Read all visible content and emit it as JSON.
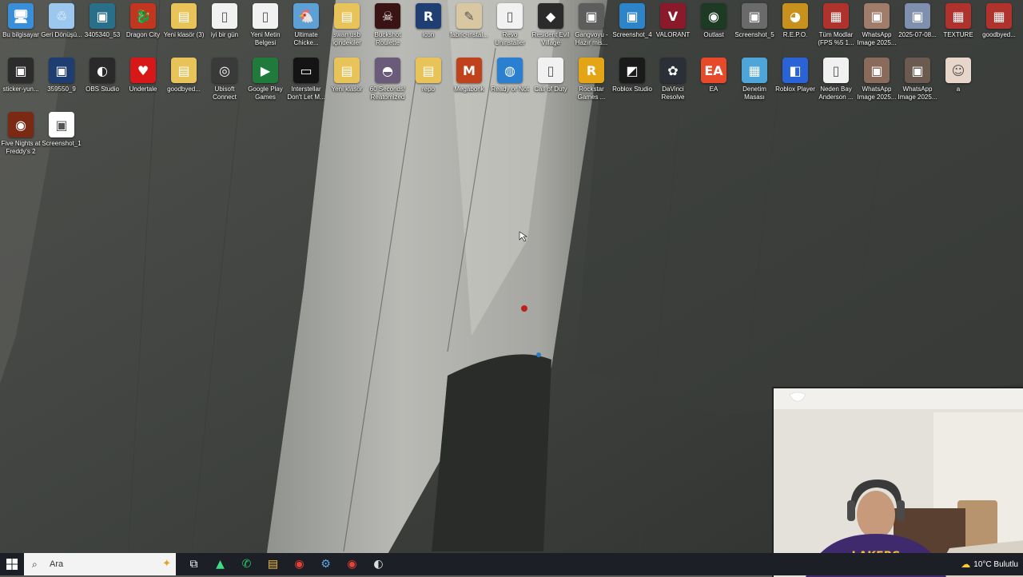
{
  "desktop": {
    "icons_row1": [
      {
        "label": "Bu bilgisayar",
        "icon": "computer-icon",
        "color": "#3b8fd9",
        "glyph": "🖥"
      },
      {
        "label": "Geri Dönüşü...",
        "icon": "recycle-bin-icon",
        "color": "#9cc7ef",
        "glyph": "♲"
      },
      {
        "label": "3405340_53",
        "icon": "image-file-icon",
        "color": "#2a6f8a",
        "glyph": "▣"
      },
      {
        "label": "Dragon City",
        "icon": "dragon-city-icon",
        "color": "#c2351e",
        "glyph": "🐉"
      },
      {
        "label": "Yeni klasör (3)",
        "icon": "folder-icon",
        "color": "#e8c35a",
        "glyph": "▤"
      },
      {
        "label": "iyi bir gün",
        "icon": "text-file-icon",
        "color": "#f1f1f1",
        "glyph": "▯"
      },
      {
        "label": "Yeni Metin Belgesi",
        "icon": "text-file-icon",
        "color": "#f1f1f1",
        "glyph": "▯"
      },
      {
        "label": "Ultimate Chicke...",
        "icon": "ultimate-chicken-horse-icon",
        "color": "#5ca0d6",
        "glyph": "🐔"
      },
      {
        "label": "swan usb içindekiler",
        "icon": "folder-icon",
        "color": "#e8c35a",
        "glyph": "▤"
      },
      {
        "label": "Buckshot Roulette",
        "icon": "buckshot-roulette-icon",
        "color": "#3a1414",
        "glyph": "☠"
      },
      {
        "label": "icon",
        "icon": "r-app-icon",
        "color": "#1f3f73",
        "glyph": "R"
      },
      {
        "label": "fabric-instal...",
        "icon": "fabric-installer-icon",
        "color": "#d8c7a0",
        "glyph": "✎"
      },
      {
        "label": "Revo Uninstaller",
        "icon": "text-file-icon",
        "color": "#f1f1f1",
        "glyph": "▯"
      },
      {
        "label": "Resident Evil Village",
        "icon": "resident-evil-icon",
        "color": "#2b2b2b",
        "glyph": "◆"
      },
      {
        "label": "Gangvoyu - Hazır mis...",
        "icon": "game-icon",
        "color": "#5d5d5d",
        "glyph": "▣"
      },
      {
        "label": "Screenshot_4",
        "icon": "image-file-icon",
        "color": "#2d84c9",
        "glyph": "▣"
      },
      {
        "label": "VALORANT",
        "icon": "valorant-icon",
        "color": "#8a1a2a",
        "glyph": "V"
      },
      {
        "label": "Outlast",
        "icon": "outlast-icon",
        "color": "#1d3a24",
        "glyph": "◉"
      },
      {
        "label": "Screenshot_5",
        "icon": "image-file-icon",
        "color": "#6a6a6a",
        "glyph": "▣"
      },
      {
        "label": "R.E.P.O.",
        "icon": "repo-game-icon",
        "color": "#c8901c",
        "glyph": "◕"
      },
      {
        "label": "Tüm Modlar (FPS %5 1...",
        "icon": "winrar-icon",
        "color": "#b0322c",
        "glyph": "▦"
      },
      {
        "label": "WhatsApp Image 2025...",
        "icon": "image-file-icon",
        "color": "#a07c6a",
        "glyph": "▣"
      },
      {
        "label": "2025-07-08...",
        "icon": "image-file-icon",
        "color": "#7f8fae",
        "glyph": "▣"
      },
      {
        "label": "TEXTURE",
        "icon": "winrar-icon",
        "color": "#b0322c",
        "glyph": "▦"
      },
      {
        "label": "goodbyed...",
        "icon": "winrar-icon",
        "color": "#b0322c",
        "glyph": "▦"
      }
    ],
    "icons_row2": [
      {
        "label": "sticker-yun...",
        "icon": "image-file-icon",
        "color": "#2c2c2c",
        "glyph": "▣"
      },
      {
        "label": "359550_9",
        "icon": "image-file-icon",
        "color": "#1e3d70",
        "glyph": "▣"
      },
      {
        "label": "OBS Studio",
        "icon": "obs-studio-icon",
        "color": "#2a2a2a",
        "glyph": "◐"
      },
      {
        "label": "Undertale",
        "icon": "undertale-heart-icon",
        "color": "#d81818",
        "glyph": "♥"
      },
      {
        "label": "goodbyed...",
        "icon": "folder-icon",
        "color": "#e8c35a",
        "glyph": "▤"
      },
      {
        "label": "Ubisoft Connect",
        "icon": "ubisoft-icon",
        "color": "#3a3a3a",
        "glyph": "◎"
      },
      {
        "label": "Google Play Games",
        "icon": "google-play-games-icon",
        "color": "#1f7a3c",
        "glyph": "▶"
      },
      {
        "label": "Interstellar Don't Let M...",
        "icon": "video-file-icon",
        "color": "#141414",
        "glyph": "▭"
      },
      {
        "label": "Yeni klasör",
        "icon": "folder-icon",
        "color": "#e8c35a",
        "glyph": "▤"
      },
      {
        "label": "60 Seconds! Reatomized",
        "icon": "sixty-seconds-icon",
        "color": "#6b5b7a",
        "glyph": "◓"
      },
      {
        "label": "repo",
        "icon": "folder-icon",
        "color": "#e8c35a",
        "glyph": "▤"
      },
      {
        "label": "Megabonk",
        "icon": "megabonk-icon",
        "color": "#c0421c",
        "glyph": "M"
      },
      {
        "label": "Ready or Not",
        "icon": "globe-icon",
        "color": "#2a7fd0",
        "glyph": "◍"
      },
      {
        "label": "Call of Duty",
        "icon": "text-file-icon",
        "color": "#f1f1f1",
        "glyph": "▯"
      },
      {
        "label": "Rockstar Games ...",
        "icon": "rockstar-icon",
        "color": "#e3a516",
        "glyph": "R"
      },
      {
        "label": "Roblox Studio",
        "icon": "roblox-studio-icon",
        "color": "#1a1a1a",
        "glyph": "◩"
      },
      {
        "label": "DaVinci Resolve",
        "icon": "davinci-resolve-icon",
        "color": "#2a2f38",
        "glyph": "✿"
      },
      {
        "label": "EA",
        "icon": "ea-icon",
        "color": "#e64a2a",
        "glyph": "EA"
      },
      {
        "label": "Denetim Masası",
        "icon": "control-panel-icon",
        "color": "#4fa4d8",
        "glyph": "▦"
      },
      {
        "label": "Roblox Player",
        "icon": "roblox-player-icon",
        "color": "#2a63d6",
        "glyph": "◧"
      },
      {
        "label": "Neden Bay Anderson ...",
        "icon": "text-file-icon",
        "color": "#f1f1f1",
        "glyph": "▯"
      },
      {
        "label": "WhatsApp Image 2025...",
        "icon": "image-file-icon",
        "color": "#8a6a5a",
        "glyph": "▣"
      },
      {
        "label": "WhatsApp Image 2025...",
        "icon": "image-file-icon",
        "color": "#6a5a50",
        "glyph": "▣"
      },
      {
        "label": "a",
        "icon": "image-file-icon",
        "color": "#e7d6c9",
        "glyph": "☺"
      }
    ],
    "icons_row3": [
      {
        "label": "Five Nights at Freddy's 2",
        "icon": "fnaf-icon",
        "color": "#7a2a14",
        "glyph": "◉"
      },
      {
        "label": "Screenshot_1",
        "icon": "image-file-icon",
        "color": "#ffffff",
        "glyph": "▣"
      }
    ]
  },
  "taskbar": {
    "search_placeholder": "Ara",
    "apps": [
      {
        "icon": "task-view-icon",
        "glyph": "⧉",
        "color": "#ffffff"
      },
      {
        "icon": "android-studio-icon",
        "glyph": "▲",
        "color": "#3ddc84"
      },
      {
        "icon": "whatsapp-icon",
        "glyph": "✆",
        "color": "#25d366"
      },
      {
        "icon": "file-explorer-icon",
        "glyph": "▤",
        "color": "#f1c232"
      },
      {
        "icon": "chrome-icon",
        "glyph": "◉",
        "color": "#e94235"
      },
      {
        "icon": "settings-app-icon",
        "glyph": "⚙",
        "color": "#5aa9e6"
      },
      {
        "icon": "chrome-icon",
        "glyph": "◉",
        "color": "#e94235"
      },
      {
        "icon": "obs-studio-icon",
        "glyph": "◐",
        "color": "#dddddd"
      }
    ],
    "weather": "10°C  Bulutlu"
  }
}
